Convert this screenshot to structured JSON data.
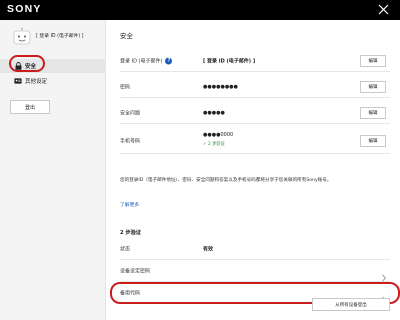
{
  "header": {
    "brand": "SONY",
    "close_icon": "close-icon"
  },
  "sidebar": {
    "account_id": "[ 登录 ID (电子邮件) ]",
    "items": [
      {
        "label": "安全",
        "icon": "lock-icon",
        "active": true
      },
      {
        "label": "其他设定",
        "icon": "id-card-icon",
        "active": false
      }
    ],
    "logout_label": "登出"
  },
  "main": {
    "title": "安全",
    "rows": [
      {
        "label": "登录 ID (电子邮件)",
        "value": "[ 登录 ID (电子邮件) ]",
        "edit": "编辑"
      },
      {
        "label": "密码",
        "value": "●●●●●●●●",
        "edit": "编辑"
      },
      {
        "label": "安全问题",
        "value": "●●●●●",
        "edit": "编辑"
      },
      {
        "label": "手机号码",
        "value": "●●●●0000",
        "verified": "✓ 2 步验证",
        "edit": "编辑"
      }
    ],
    "info_text": "您的登录ID（电子邮件地址）、密码、安全问题和答案以及手机号码都将分享于您关联的所有Sony账号。",
    "learn_more": "了解更多",
    "two_step": {
      "title": "2 步验证",
      "status_label": "状态",
      "status_value": "有效",
      "device_password_label": "设备设定密码",
      "backup_codes_label": "备用代码"
    },
    "signout_all_label": "从所有设备登出"
  },
  "colors": {
    "topbar": "#000000",
    "highlight_ring": "#c81e1e",
    "link": "#1d5cbf",
    "verified": "#2a8a3a"
  }
}
